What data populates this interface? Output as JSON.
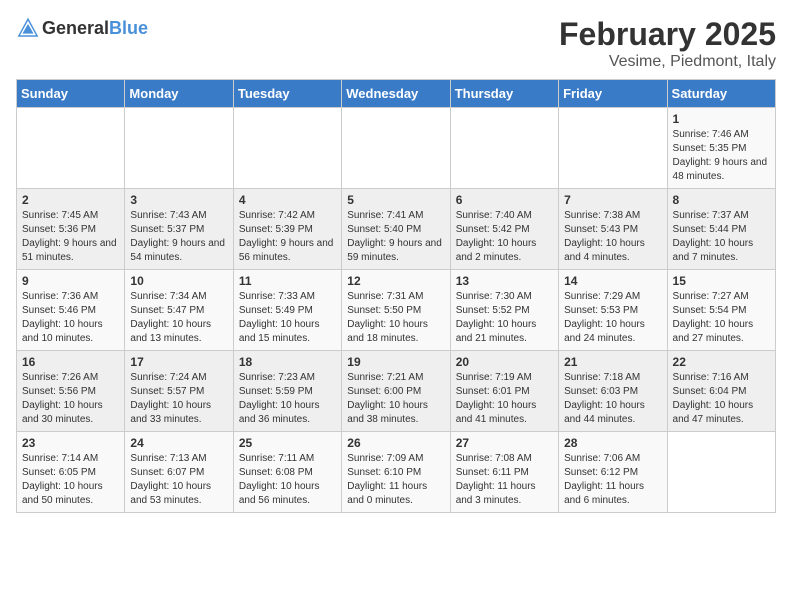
{
  "header": {
    "logo": {
      "general": "General",
      "blue": "Blue"
    },
    "title": "February 2025",
    "subtitle": "Vesime, Piedmont, Italy"
  },
  "calendar": {
    "days_of_week": [
      "Sunday",
      "Monday",
      "Tuesday",
      "Wednesday",
      "Thursday",
      "Friday",
      "Saturday"
    ],
    "weeks": [
      [
        {
          "day": "",
          "info": ""
        },
        {
          "day": "",
          "info": ""
        },
        {
          "day": "",
          "info": ""
        },
        {
          "day": "",
          "info": ""
        },
        {
          "day": "",
          "info": ""
        },
        {
          "day": "",
          "info": ""
        },
        {
          "day": "1",
          "info": "Sunrise: 7:46 AM\nSunset: 5:35 PM\nDaylight: 9 hours and 48 minutes."
        }
      ],
      [
        {
          "day": "2",
          "info": "Sunrise: 7:45 AM\nSunset: 5:36 PM\nDaylight: 9 hours and 51 minutes."
        },
        {
          "day": "3",
          "info": "Sunrise: 7:43 AM\nSunset: 5:37 PM\nDaylight: 9 hours and 54 minutes."
        },
        {
          "day": "4",
          "info": "Sunrise: 7:42 AM\nSunset: 5:39 PM\nDaylight: 9 hours and 56 minutes."
        },
        {
          "day": "5",
          "info": "Sunrise: 7:41 AM\nSunset: 5:40 PM\nDaylight: 9 hours and 59 minutes."
        },
        {
          "day": "6",
          "info": "Sunrise: 7:40 AM\nSunset: 5:42 PM\nDaylight: 10 hours and 2 minutes."
        },
        {
          "day": "7",
          "info": "Sunrise: 7:38 AM\nSunset: 5:43 PM\nDaylight: 10 hours and 4 minutes."
        },
        {
          "day": "8",
          "info": "Sunrise: 7:37 AM\nSunset: 5:44 PM\nDaylight: 10 hours and 7 minutes."
        }
      ],
      [
        {
          "day": "9",
          "info": "Sunrise: 7:36 AM\nSunset: 5:46 PM\nDaylight: 10 hours and 10 minutes."
        },
        {
          "day": "10",
          "info": "Sunrise: 7:34 AM\nSunset: 5:47 PM\nDaylight: 10 hours and 13 minutes."
        },
        {
          "day": "11",
          "info": "Sunrise: 7:33 AM\nSunset: 5:49 PM\nDaylight: 10 hours and 15 minutes."
        },
        {
          "day": "12",
          "info": "Sunrise: 7:31 AM\nSunset: 5:50 PM\nDaylight: 10 hours and 18 minutes."
        },
        {
          "day": "13",
          "info": "Sunrise: 7:30 AM\nSunset: 5:52 PM\nDaylight: 10 hours and 21 minutes."
        },
        {
          "day": "14",
          "info": "Sunrise: 7:29 AM\nSunset: 5:53 PM\nDaylight: 10 hours and 24 minutes."
        },
        {
          "day": "15",
          "info": "Sunrise: 7:27 AM\nSunset: 5:54 PM\nDaylight: 10 hours and 27 minutes."
        }
      ],
      [
        {
          "day": "16",
          "info": "Sunrise: 7:26 AM\nSunset: 5:56 PM\nDaylight: 10 hours and 30 minutes."
        },
        {
          "day": "17",
          "info": "Sunrise: 7:24 AM\nSunset: 5:57 PM\nDaylight: 10 hours and 33 minutes."
        },
        {
          "day": "18",
          "info": "Sunrise: 7:23 AM\nSunset: 5:59 PM\nDaylight: 10 hours and 36 minutes."
        },
        {
          "day": "19",
          "info": "Sunrise: 7:21 AM\nSunset: 6:00 PM\nDaylight: 10 hours and 38 minutes."
        },
        {
          "day": "20",
          "info": "Sunrise: 7:19 AM\nSunset: 6:01 PM\nDaylight: 10 hours and 41 minutes."
        },
        {
          "day": "21",
          "info": "Sunrise: 7:18 AM\nSunset: 6:03 PM\nDaylight: 10 hours and 44 minutes."
        },
        {
          "day": "22",
          "info": "Sunrise: 7:16 AM\nSunset: 6:04 PM\nDaylight: 10 hours and 47 minutes."
        }
      ],
      [
        {
          "day": "23",
          "info": "Sunrise: 7:14 AM\nSunset: 6:05 PM\nDaylight: 10 hours and 50 minutes."
        },
        {
          "day": "24",
          "info": "Sunrise: 7:13 AM\nSunset: 6:07 PM\nDaylight: 10 hours and 53 minutes."
        },
        {
          "day": "25",
          "info": "Sunrise: 7:11 AM\nSunset: 6:08 PM\nDaylight: 10 hours and 56 minutes."
        },
        {
          "day": "26",
          "info": "Sunrise: 7:09 AM\nSunset: 6:10 PM\nDaylight: 11 hours and 0 minutes."
        },
        {
          "day": "27",
          "info": "Sunrise: 7:08 AM\nSunset: 6:11 PM\nDaylight: 11 hours and 3 minutes."
        },
        {
          "day": "28",
          "info": "Sunrise: 7:06 AM\nSunset: 6:12 PM\nDaylight: 11 hours and 6 minutes."
        },
        {
          "day": "",
          "info": ""
        }
      ]
    ]
  }
}
